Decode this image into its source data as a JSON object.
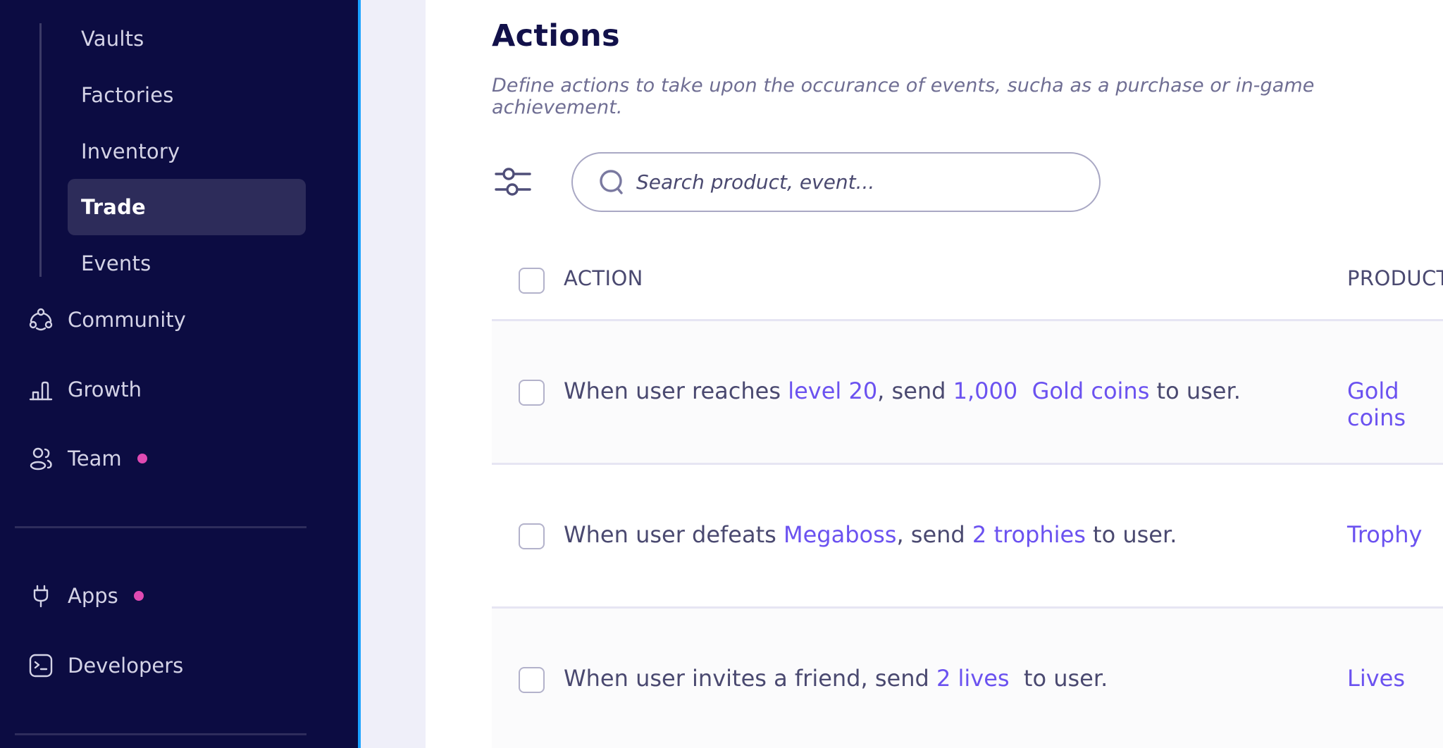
{
  "colors": {
    "sidebar_bg": "#0c0c42",
    "sidebar_active_bg": "#2d2c5a",
    "accent_edge": "#1aa2ff",
    "notification_dot": "#e04ab2",
    "title_color": "#12114a",
    "link_color": "#6b52f0",
    "text_color": "#4a4970"
  },
  "sidebar": {
    "sub_items": [
      {
        "label": "Vaults",
        "active": false
      },
      {
        "label": "Factories",
        "active": false
      },
      {
        "label": "Inventory",
        "active": false
      },
      {
        "label": "Trade",
        "active": true
      },
      {
        "label": "Events",
        "active": false
      }
    ],
    "nav_items": [
      {
        "label": "Community",
        "icon": "community-icon",
        "badge": false
      },
      {
        "label": "Growth",
        "icon": "bar-chart-icon",
        "badge": false
      },
      {
        "label": "Team",
        "icon": "team-icon",
        "badge": true
      }
    ],
    "bottom_items": [
      {
        "label": "Apps",
        "icon": "plug-icon",
        "badge": true
      },
      {
        "label": "Developers",
        "icon": "terminal-icon",
        "badge": false
      }
    ]
  },
  "header": {
    "title": "Actions",
    "subtitle": "Define actions to take upon the occurance of events, sucha as a purchase or in-game achievement."
  },
  "toolbar": {
    "filter_icon": "sliders-icon",
    "search_placeholder": "Search product, event..."
  },
  "table": {
    "columns": [
      "ACTION",
      "PRODUCT"
    ],
    "rows": [
      {
        "action_parts": [
          {
            "text": "When user reaches ",
            "link": false
          },
          {
            "text": "level 20",
            "link": true
          },
          {
            "text": ", send ",
            "link": false
          },
          {
            "text": "1,000",
            "link": true
          },
          {
            "text": "  ",
            "link": false
          },
          {
            "text": "Gold coins",
            "link": true
          },
          {
            "text": " to user.",
            "link": false
          }
        ],
        "product": "Gold coins"
      },
      {
        "action_parts": [
          {
            "text": "When user defeats ",
            "link": false
          },
          {
            "text": "Megaboss",
            "link": true
          },
          {
            "text": ", send ",
            "link": false
          },
          {
            "text": "2 trophies",
            "link": true
          },
          {
            "text": " to user.",
            "link": false
          }
        ],
        "product": "Trophy"
      },
      {
        "action_parts": [
          {
            "text": "When user invites a friend, send ",
            "link": false
          },
          {
            "text": "2 lives",
            "link": true
          },
          {
            "text": "  to user.",
            "link": false
          }
        ],
        "product": "Lives"
      }
    ]
  }
}
